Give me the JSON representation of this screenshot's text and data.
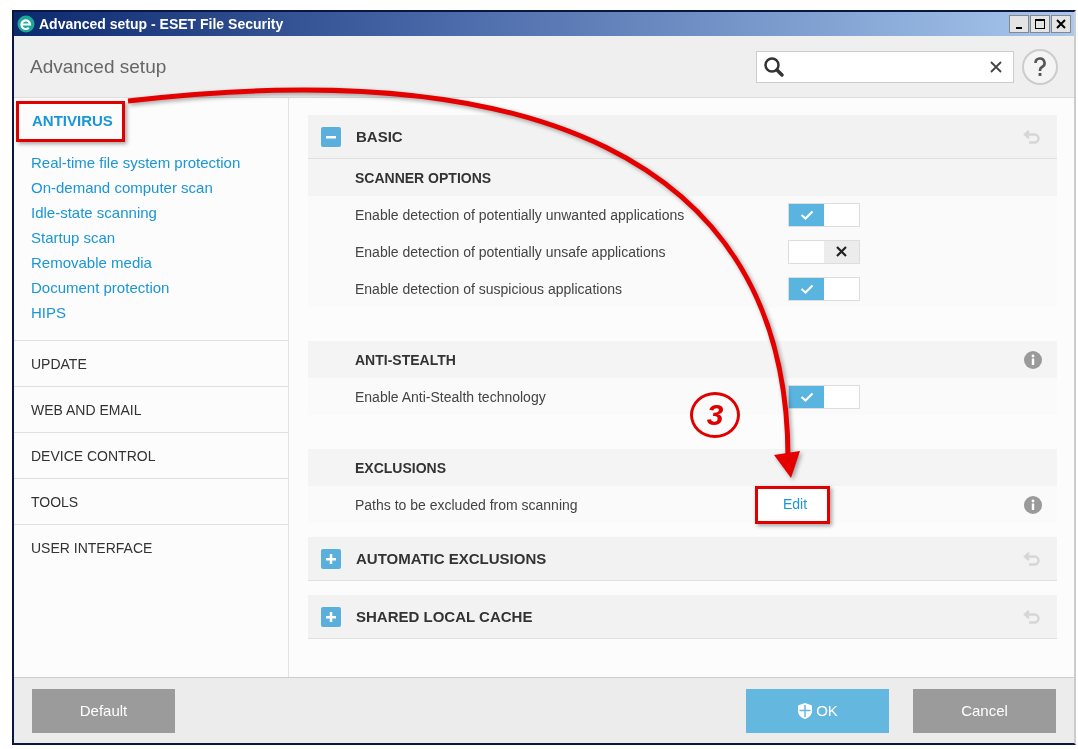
{
  "window": {
    "title": "Advanced setup - ESET File Security"
  },
  "header": {
    "title": "Advanced setup"
  },
  "sidebar": {
    "items": [
      {
        "label": "ANTIVIRUS",
        "selected": true,
        "highlighted": true,
        "children": [
          {
            "label": "Real-time file system protection"
          },
          {
            "label": "On-demand computer scan"
          },
          {
            "label": "Idle-state scanning"
          },
          {
            "label": "Startup scan"
          },
          {
            "label": "Removable media"
          },
          {
            "label": "Document protection"
          },
          {
            "label": "HIPS"
          }
        ]
      },
      {
        "label": "UPDATE",
        "selected": false,
        "highlighted": false
      },
      {
        "label": "WEB AND EMAIL",
        "selected": false,
        "highlighted": false
      },
      {
        "label": "DEVICE CONTROL",
        "selected": false,
        "highlighted": false
      },
      {
        "label": "TOOLS",
        "selected": false,
        "highlighted": false
      },
      {
        "label": "USER INTERFACE",
        "selected": false,
        "highlighted": false
      }
    ]
  },
  "sections": [
    {
      "title": "BASIC",
      "expanded": true,
      "groups": [
        {
          "title": "SCANNER OPTIONS",
          "info": false,
          "rows": [
            {
              "kind": "toggle",
              "label": "Enable detection of potentially unwanted applications",
              "on": true,
              "info": false
            },
            {
              "kind": "toggle",
              "label": "Enable detection of potentially unsafe applications",
              "on": false,
              "info": false
            },
            {
              "kind": "toggle",
              "label": "Enable detection of suspicious applications",
              "on": true,
              "info": false
            }
          ]
        },
        {
          "title": "ANTI-STEALTH",
          "info": true,
          "rows": [
            {
              "kind": "toggle",
              "label": "Enable Anti-Stealth technology",
              "on": true,
              "info": false
            }
          ]
        },
        {
          "title": "EXCLUSIONS",
          "info": false,
          "rows": [
            {
              "kind": "link",
              "label": "Paths to be excluded from scanning",
              "action": "Edit",
              "highlighted": true,
              "info": true
            }
          ]
        }
      ]
    },
    {
      "title": "AUTOMATIC EXCLUSIONS",
      "expanded": false
    },
    {
      "title": "SHARED LOCAL CACHE",
      "expanded": false
    }
  ],
  "buttons": [
    {
      "label": "Default",
      "kind": "secondary"
    },
    {
      "label": "OK",
      "kind": "primary"
    },
    {
      "label": "Cancel",
      "kind": "secondary"
    }
  ],
  "annotation": {
    "step": "3"
  }
}
